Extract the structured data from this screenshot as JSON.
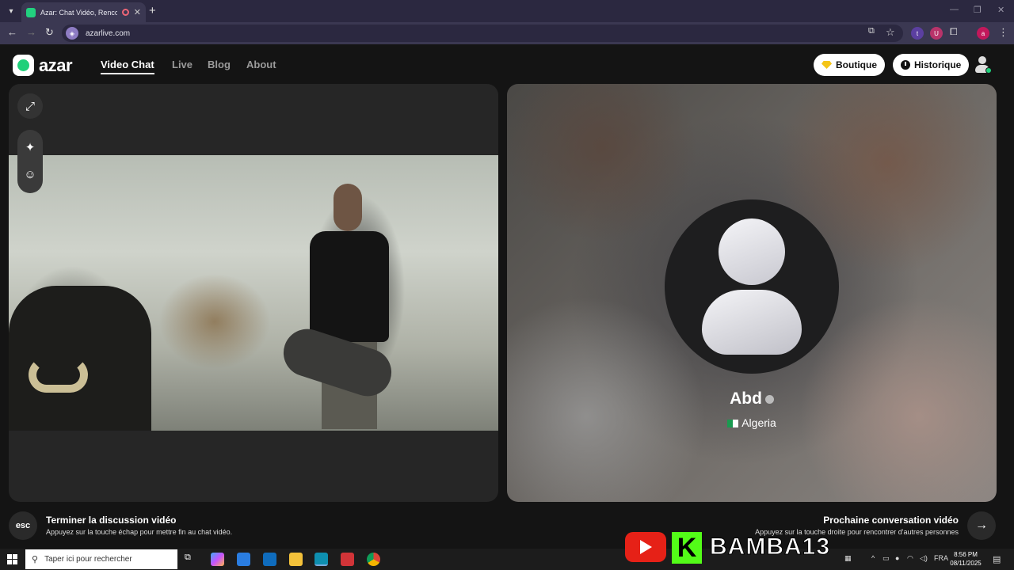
{
  "browser": {
    "tab_title": "Azar: Chat Vidéo, Rencontre",
    "tab_close": "✕",
    "new_tab": "+",
    "url": "azarlive.com",
    "extensions": [
      "t",
      "U",
      "a"
    ]
  },
  "header": {
    "logo": "azar",
    "nav": [
      "Video Chat",
      "Live",
      "Blog",
      "About"
    ],
    "active_nav": "Video Chat",
    "boutique_label": "Boutique",
    "historique_label": "Historique"
  },
  "partner": {
    "name": "Abd",
    "country": "Algeria"
  },
  "footer": {
    "esc_key": "esc",
    "end_title": "Terminer la discussion vidéo",
    "end_sub": "Appuyez sur la touche échap pour mettre fin au chat vidéo.",
    "next_title": "Prochaine conversation vidéo",
    "next_sub": "Appuyez sur la touche droite pour rencontrer d'autres personnes"
  },
  "taskbar": {
    "search_placeholder": "Taper ici pour rechercher",
    "language": "FRA",
    "time": "8:56 PM",
    "date": "08/11/2025"
  },
  "watermark": {
    "kick_letter": "K",
    "channel": "BAMBA13"
  },
  "colors": {
    "accent_green": "#1fd07a",
    "youtube_red": "#e62117",
    "kick_green": "#53fc18"
  }
}
